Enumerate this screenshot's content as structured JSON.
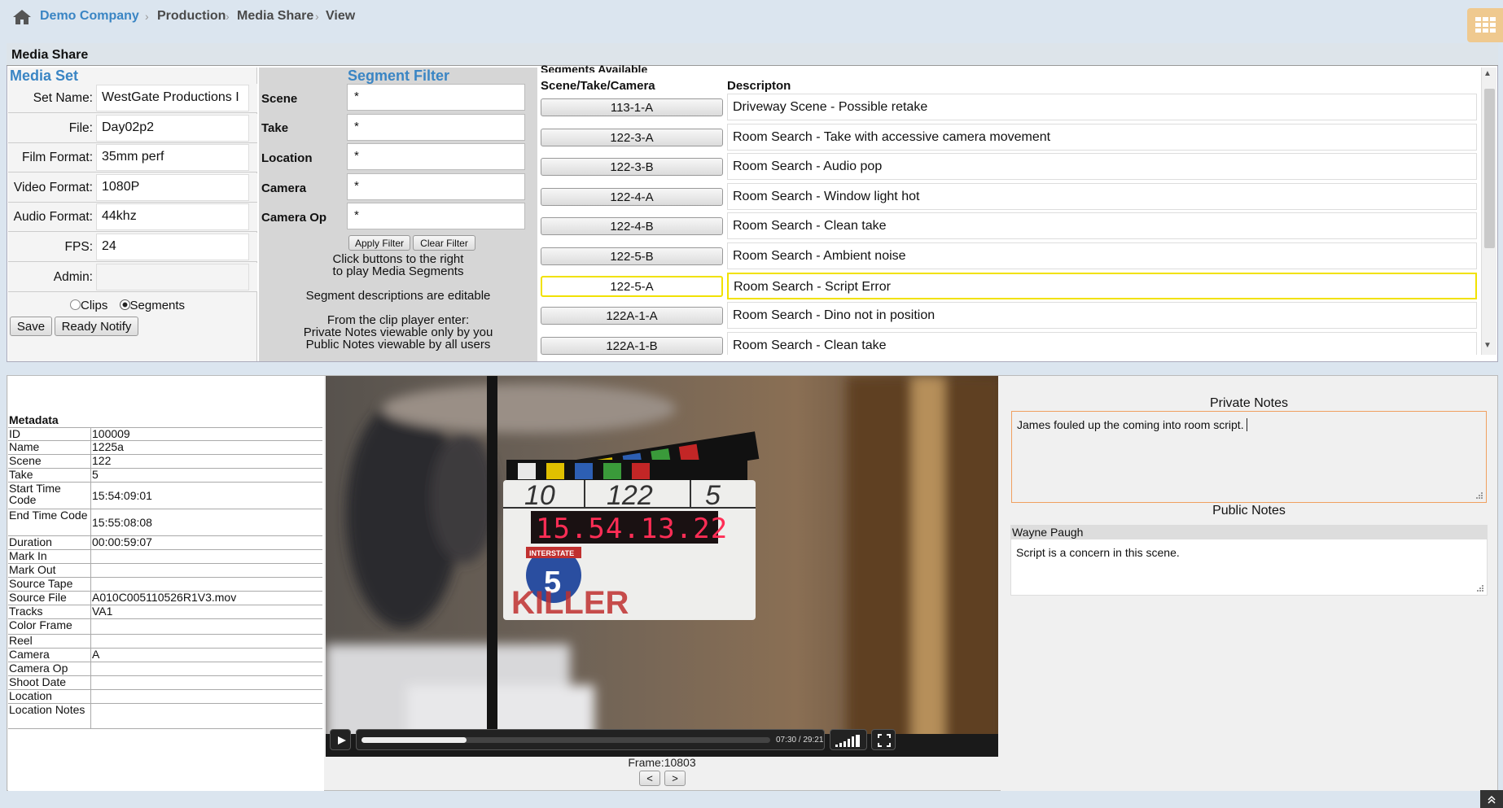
{
  "breadcrumb": [
    "Demo Company",
    "Production",
    "Media Share",
    "View"
  ],
  "panel_title": "Media Share",
  "media_set": {
    "title": "Media Set",
    "fields": [
      {
        "label": "Set Name:",
        "value": "WestGate Productions I"
      },
      {
        "label": "File:",
        "value": "Day02p2"
      },
      {
        "label": "Film Format:",
        "value": "35mm perf"
      },
      {
        "label": "Video Format:",
        "value": "1080P"
      },
      {
        "label": "Audio Format:",
        "value": "44khz"
      },
      {
        "label": "FPS:",
        "value": "24"
      },
      {
        "label": "Admin:",
        "value": ""
      }
    ],
    "radio_clips": "Clips",
    "radio_segments": "Segments",
    "save_label": "Save",
    "ready_label": "Ready Notify"
  },
  "segment_filter": {
    "title": "Segment Filter",
    "fields": [
      {
        "label": "Scene",
        "value": "*"
      },
      {
        "label": "Take",
        "value": "*"
      },
      {
        "label": "Location",
        "value": "*"
      },
      {
        "label": "Camera",
        "value": "*"
      },
      {
        "label": "Camera Op",
        "value": "*"
      }
    ],
    "apply_label": "Apply Filter",
    "clear_label": "Clear Filter",
    "help1a": "Click buttons to the right",
    "help1b": "to play Media Segments",
    "help2": "Segment descriptions are editable",
    "help3a": "From the clip player enter:",
    "help3b": "Private Notes viewable only by you",
    "help3c": "Public Notes viewable by all users"
  },
  "segments": {
    "header_top": "Segments Available",
    "header_col1": "Scene/Take/Camera",
    "header_col2": "Descripton",
    "rows": [
      {
        "id": "113-1-A",
        "desc": "Driveway Scene - Possible retake"
      },
      {
        "id": "122-3-A",
        "desc": "Room Search - Take with accessive camera movement"
      },
      {
        "id": "122-3-B",
        "desc": "Room Search - Audio pop"
      },
      {
        "id": "122-4-A",
        "desc": "Room Search - Window light hot"
      },
      {
        "id": "122-4-B",
        "desc": "Room Search - Clean take"
      },
      {
        "id": "122-5-B",
        "desc": "Room Search - Ambient noise"
      },
      {
        "id": "122-5-A",
        "desc": "Room Search - Script Error"
      },
      {
        "id": "122A-1-A",
        "desc": "Room Search - Dino not in position"
      },
      {
        "id": "122A-1-B",
        "desc": "Room Search - Clean take"
      }
    ]
  },
  "metadata": {
    "title": "Metadata",
    "rows": [
      {
        "k": "ID",
        "v": "100009"
      },
      {
        "k": "Name",
        "v": "1225a"
      },
      {
        "k": "Scene",
        "v": "122"
      },
      {
        "k": "Take",
        "v": "5"
      },
      {
        "k": "Start Time Code",
        "v": "15:54:09:01"
      },
      {
        "k": "End Time Code",
        "v": "15:55:08:08"
      },
      {
        "k": "Duration",
        "v": "00:00:59:07"
      },
      {
        "k": "Mark In",
        "v": ""
      },
      {
        "k": "Mark Out",
        "v": ""
      },
      {
        "k": "Source Tape",
        "v": ""
      },
      {
        "k": "Source File",
        "v": "A010C005110526R1V3.mov"
      },
      {
        "k": "Tracks",
        "v": "VA1"
      },
      {
        "k": "Color Frame",
        "v": ""
      },
      {
        "k": "Reel",
        "v": ""
      },
      {
        "k": "Camera",
        "v": "A"
      },
      {
        "k": "Camera Op",
        "v": ""
      },
      {
        "k": "Shoot Date",
        "v": ""
      },
      {
        "k": "Location",
        "v": ""
      },
      {
        "k": "Location Notes",
        "v": ""
      }
    ]
  },
  "player": {
    "time": "07:30 / 29:21",
    "progress": 0.256,
    "frame_label": "Frame:10803",
    "prev": "<",
    "next": ">",
    "slate": {
      "scene_num": "10",
      "roll": "122",
      "take": "5",
      "timecode": "15.54.13.22",
      "logo": "INTERSTATE",
      "logo_num": "5",
      "title": "KILLER"
    }
  },
  "notes": {
    "private_title": "Private Notes",
    "private_text": "James fouled up the coming into room script.",
    "public_title": "Public Notes",
    "public_author": "Wayne Paugh",
    "public_text": "Script is a concern in this scene."
  }
}
